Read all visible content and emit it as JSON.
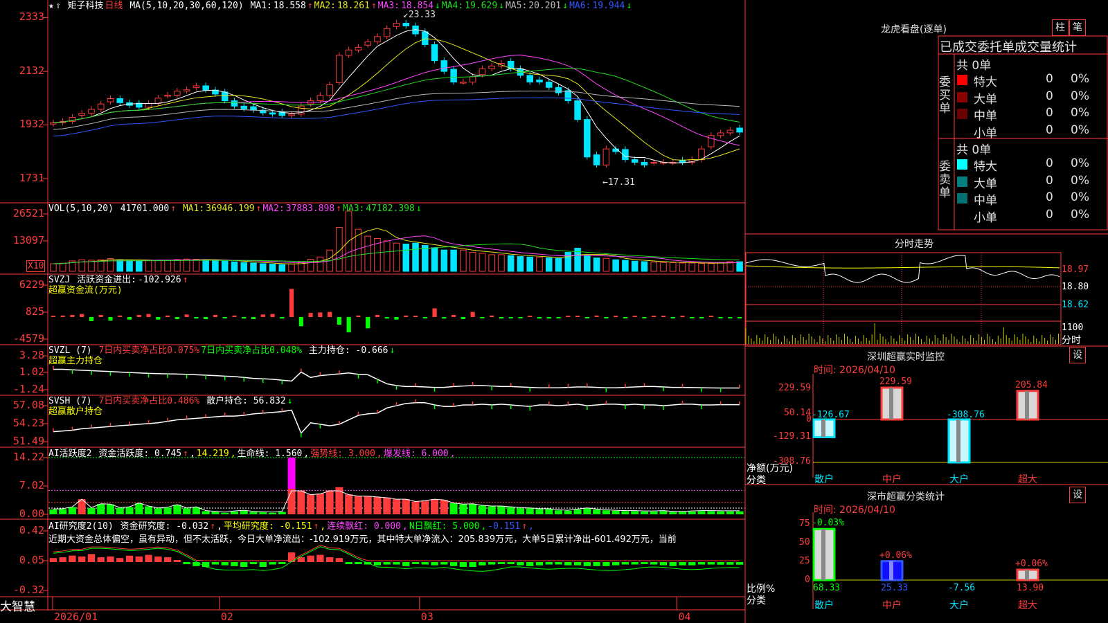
{
  "stock": {
    "name": "矩子科技",
    "period": "日线"
  },
  "colors": {
    "up": "#ff3c3c",
    "down": "#00e5ff",
    "bg": "#000000",
    "grid": "#ff3c3c",
    "ma1": "#ffffff",
    "ma2": "#e6e61e",
    "ma3": "#ff44ff",
    "ma4": "#22dd22",
    "ma5": "#bbbbbb",
    "ma6": "#3355ff"
  },
  "price_panel": {
    "ma_label": "MA(5,10,20,30,60,120)",
    "ma": [
      {
        "name": "MA1:",
        "value": "18.558",
        "arrow": "↑"
      },
      {
        "name": "MA2:",
        "value": "18.261",
        "arrow": "↑"
      },
      {
        "name": "MA3:",
        "value": "18.854",
        "arrow": "↓"
      },
      {
        "name": "MA4:",
        "value": "19.629",
        "arrow": "↓"
      },
      {
        "name": "MA5:",
        "value": "20.201",
        "arrow": "↓"
      },
      {
        "name": "MA6:",
        "value": "19.944",
        "arrow": "↓"
      }
    ],
    "y_ticks": [
      "2333",
      "2132",
      "1932",
      "1731"
    ],
    "high_label": "23.33",
    "low_label": "17.31"
  },
  "vol_panel": {
    "label": "VOL(5,10,20)",
    "value": "41701.000",
    "value_arrow": "↑",
    "ma": [
      {
        "name": "MA1:",
        "value": "36946.199",
        "arrow": "↑"
      },
      {
        "name": "MA2:",
        "value": "37883.898",
        "arrow": "↑"
      },
      {
        "name": "MA3:",
        "value": "47182.398",
        "arrow": "↓"
      }
    ],
    "y_ticks": [
      "26521",
      "13097"
    ],
    "unit": "X10"
  },
  "svzj_panel": {
    "label": "SVZJ",
    "item": "活跃资金进出:",
    "value": "-102.926",
    "arrow": "↑",
    "subtitle": "超赢资金流(万元)",
    "y_ticks": [
      "6229",
      "825",
      "-4579"
    ]
  },
  "svzl_panel": {
    "label": "SVZL (7)",
    "item1": "7日内买卖净占比0.075%",
    "item2": "7日内买卖净占比0.048%",
    "item3": "主力持仓: -0.666",
    "arrow": "↓",
    "subtitle": "超赢主力持仓",
    "y_ticks": [
      "3.28",
      "1.02",
      "-1.24"
    ]
  },
  "svsh_panel": {
    "label": "SVSH (7)",
    "item1": "7日内买卖净占比0.486%",
    "item2": "散户持仓: 56.832",
    "arrow": "↓",
    "subtitle": "超赢散户持仓",
    "y_ticks": [
      "57.08",
      "54.23",
      "51.49"
    ]
  },
  "ai_panel": {
    "label": "AI活跃度2",
    "items": [
      {
        "text": "资金活跃度: 0.745",
        "arrow": "↑",
        "color": "#ffffff"
      },
      {
        "text": "14.219",
        "arrow": "",
        "color": "#ffff00"
      },
      {
        "text": "生命线: 1.560",
        "arrow": "",
        "color": "#ffffff"
      },
      {
        "text": "强势线: 3.000",
        "arrow": "",
        "color": "#ff3c3c"
      },
      {
        "text": "爆发线: 6.000",
        "arrow": "",
        "color": "#ff44ff"
      }
    ],
    "y_ticks": [
      "14.22",
      "7.02",
      "0.00"
    ]
  },
  "research_panel": {
    "label": "AI研究度2(10)",
    "items": [
      {
        "text": "资金研究度: -0.032",
        "arrow": "↑",
        "color": "#ffffff"
      },
      {
        "text": "平均研究度: -0.151",
        "arrow": "↑",
        "color": "#ffff00"
      },
      {
        "text": "连续飘红: 0.000",
        "arrow": "",
        "color": "#ff44ff"
      },
      {
        "text": "N日飘红: 5.000",
        "arrow": "",
        "color": "#00ff00"
      },
      {
        "text": "-0.151",
        "arrow": "↑",
        "color": "#3355ff"
      }
    ],
    "commentary": "近期大资金总体偏空，虽有异动，但不太活跃，今日大单净流出：-102.919万元，其中特大单净流入：205.839万元，大单5日累计净出-601.492万元，当前",
    "y_ticks": [
      "0.42",
      "0.05",
      "-0.32"
    ]
  },
  "x_axis": {
    "labels": [
      "2026/01",
      "02",
      "03",
      "04"
    ],
    "brand": "大智慧"
  },
  "dragon_tiger": {
    "title": "龙虎看盘(逐单)",
    "btn_bar": "柱",
    "btn_pen": "笔",
    "header": "已成交委托单成交量统计",
    "buy": {
      "side": "委买单",
      "total": "共 0单",
      "rows": [
        {
          "label": "特大",
          "count": "0",
          "pct": "0%",
          "color": "#ff0000"
        },
        {
          "label": "大单",
          "count": "0",
          "pct": "0%",
          "color": "#8b0000"
        },
        {
          "label": "中单",
          "count": "0",
          "pct": "0%",
          "color": "#6b0000"
        },
        {
          "label": "小单",
          "count": "0",
          "pct": "0%",
          "color": "#000000"
        }
      ]
    },
    "sell": {
      "side": "委卖单",
      "total": "共 0单",
      "rows": [
        {
          "label": "特大",
          "count": "0",
          "pct": "0%",
          "color": "#00ffff"
        },
        {
          "label": "大单",
          "count": "0",
          "pct": "0%",
          "color": "#008080"
        },
        {
          "label": "中单",
          "count": "0",
          "pct": "0%",
          "color": "#007070"
        },
        {
          "label": "小单",
          "count": "0",
          "pct": "0%",
          "color": "#000000"
        }
      ]
    }
  },
  "intraday": {
    "title": "分时走势",
    "y_ticks": [
      "18.97",
      "18.80",
      "18.62"
    ],
    "vol_tick": "1100",
    "unit": "分时"
  },
  "monitor": {
    "title": "深圳超赢实时监控",
    "btn": "设",
    "time": "时间: 2026/04/10",
    "y_ticks": [
      "229.59",
      "50.14",
      "0",
      "-129.31",
      "-308.76"
    ],
    "ylabel1": "净额(万元)",
    "ylabel2": "分类",
    "categories": [
      "散户",
      "中户",
      "大户",
      "超大"
    ],
    "values": [
      -126.67,
      229.59,
      -308.76,
      205.84
    ],
    "value_labels": [
      "-126.67",
      "229.59",
      "-308.76",
      "205.84"
    ]
  },
  "classify": {
    "title": "深市超赢分类统计",
    "btn": "设",
    "time": "时间: 2026/04/10",
    "y_ticks": [
      "75",
      "50",
      "25",
      "0"
    ],
    "ylabel1": "比例%",
    "ylabel2": "分类",
    "categories": [
      "散户",
      "中户",
      "大户",
      "超大"
    ],
    "values": [
      68.33,
      25.33,
      -7.56,
      13.9
    ],
    "value_labels": [
      "68.33",
      "25.33",
      "-7.56",
      "13.90"
    ],
    "change_labels": [
      "-0.03%",
      "+0.06%",
      "",
      "+0.06%"
    ]
  },
  "chart_data": [
    {
      "type": "candlestick",
      "title": "矩子科技 日线",
      "ylim": [
        17.31,
        23.33
      ],
      "series": [
        {
          "name": "price_close",
          "values": [
            19.4,
            19.45,
            19.6,
            19.75,
            19.9,
            20.1,
            20.3,
            20.15,
            20.05,
            19.98,
            20.12,
            20.32,
            20.43,
            20.58,
            20.63,
            20.78,
            20.62,
            20.47,
            20.22,
            20.02,
            19.92,
            19.87,
            19.77,
            19.72,
            19.67,
            19.72,
            20.02,
            20.22,
            20.42,
            20.82,
            21.92,
            22.12,
            22.22,
            22.42,
            22.62,
            22.92,
            23.12,
            23.02,
            22.72,
            22.32,
            21.72,
            21.32,
            20.92,
            20.92,
            21.12,
            21.42,
            21.52,
            21.62,
            21.42,
            21.17,
            20.92,
            20.92,
            20.72,
            20.52,
            20.22,
            19.52,
            18.12,
            17.82,
            18.42,
            18.32,
            18.02,
            17.92,
            17.82,
            17.92,
            17.92,
            17.92,
            17.92,
            18.02,
            18.42,
            18.92,
            19.02,
            19.12,
            19.05
          ]
        }
      ]
    },
    {
      "type": "bar",
      "title": "VOL(5,10,20)",
      "ylim": [
        0,
        26521
      ],
      "series": [
        {
          "name": "volume",
          "values": [
            3300,
            3500,
            4500,
            5000,
            4800,
            5000,
            5500,
            5000,
            4700,
            4600,
            4600,
            4700,
            4800,
            5100,
            5300,
            5200,
            5100,
            4600,
            4400,
            4100,
            3800,
            3600,
            3300,
            3100,
            2900,
            3200,
            4200,
            5200,
            6200,
            9200,
            19000,
            26000,
            18200,
            15200,
            14200,
            13200,
            12200,
            11800,
            12200,
            11200,
            10200,
            9200,
            9200,
            9200,
            8200,
            7800,
            7200,
            7200,
            6800,
            6400,
            6200,
            6000,
            5800,
            5600,
            8200,
            10000,
            6800,
            5800,
            5600,
            5000,
            4800,
            4400,
            4200,
            4000,
            3800,
            3800,
            3600,
            3600,
            3400,
            3400,
            3800,
            4200,
            4170
          ]
        }
      ]
    },
    {
      "type": "bar",
      "title": "活跃资金进出",
      "ylim": [
        -4579,
        6229
      ],
      "series": [
        {
          "name": "flow",
          "values": [
            200,
            300,
            400,
            600,
            -800,
            400,
            -700,
            300,
            -500,
            400,
            600,
            -500,
            300,
            -400,
            500,
            -300,
            -400,
            400,
            -200,
            300,
            -300,
            -400,
            500,
            600,
            -300,
            5500,
            -1800,
            800,
            900,
            1000,
            -1500,
            -3000,
            300,
            -2200,
            400,
            -300,
            -500,
            300,
            200,
            -200,
            1700,
            -300,
            400,
            -400,
            1000,
            -200,
            300,
            -300,
            -200,
            -100,
            200,
            -300,
            -300,
            -100,
            200,
            100,
            -200,
            300,
            -200,
            200,
            -100,
            100,
            -100,
            100,
            200,
            -100,
            200,
            -100,
            -200,
            100,
            -102.9,
            -102.9,
            -102.9
          ]
        }
      ]
    },
    {
      "type": "line",
      "title": "主力持仓",
      "ylim": [
        -1.24,
        3.28
      ],
      "series": [
        {
          "name": "main_position",
          "values": [
            1.4,
            1.4,
            1.35,
            1.3,
            1.25,
            1.2,
            1.15,
            1.1,
            1.05,
            1.0,
            0.95,
            0.92,
            0.9,
            0.88,
            0.85,
            0.8,
            0.75,
            0.7,
            0.65,
            0.6,
            0.5,
            0.4,
            0.35,
            0.3,
            0.2,
            0.1,
            1.1,
            0.5,
            0.7,
            0.8,
            0.9,
            1.0,
            0.85,
            0.8,
            0.3,
            -0.2,
            -0.4,
            -0.5,
            -0.5,
            -0.55,
            -0.6,
            -0.6,
            -0.5,
            -0.45,
            -0.4,
            -0.4,
            -0.45,
            -0.5,
            -0.5,
            -0.55,
            -0.6,
            -0.65,
            -0.65,
            -0.65,
            -0.6,
            -0.55,
            -0.55,
            -0.6,
            -0.65,
            -0.65,
            -0.6,
            -0.55,
            -0.5,
            -0.5,
            -0.55,
            -0.6,
            -0.6,
            -0.62,
            -0.64,
            -0.66,
            -0.666,
            -0.666,
            -0.666
          ]
        }
      ]
    },
    {
      "type": "line",
      "title": "散户持仓",
      "ylim": [
        51.49,
        57.08
      ],
      "series": [
        {
          "name": "retail_position",
          "values": [
            53.2,
            53.3,
            53.4,
            53.6,
            53.7,
            53.8,
            53.9,
            54.0,
            54.1,
            54.2,
            54.3,
            54.4,
            54.6,
            54.8,
            54.9,
            55.0,
            55.1,
            55.2,
            55.3,
            55.3,
            55.4,
            55.6,
            55.7,
            55.8,
            55.9,
            56.1,
            53.0,
            54.4,
            54.2,
            54.0,
            54.2,
            54.8,
            55.4,
            55.6,
            55.7,
            56.4,
            56.7,
            57.0,
            57.1,
            57.1,
            56.8,
            56.6,
            56.6,
            56.8,
            56.8,
            56.9,
            56.8,
            56.9,
            56.8,
            56.7,
            56.6,
            56.8,
            56.8,
            56.7,
            56.8,
            56.9,
            56.7,
            56.8,
            56.9,
            56.9,
            56.8,
            56.9,
            56.8,
            56.8,
            56.7,
            56.8,
            56.9,
            56.9,
            56.8,
            56.8,
            56.832,
            56.832,
            56.832
          ]
        }
      ]
    },
    {
      "type": "bar",
      "title": "资金活跃度",
      "ylim": [
        0,
        14.22
      ],
      "series": [
        {
          "name": "activity",
          "values": [
            1.2,
            1.3,
            1.8,
            3.8,
            1.6,
            2.6,
            2.5,
            1.6,
            1.8,
            2.8,
            2.0,
            1.5,
            1.7,
            2.4,
            1.5,
            1.8,
            0.8,
            0.6,
            0.4,
            0.7,
            0.9,
            0.6,
            0.5,
            0.4,
            0.6,
            14.22,
            6.0,
            5.0,
            5.2,
            6.0,
            6.8,
            5.0,
            4.6,
            4.6,
            4.4,
            4.2,
            3.8,
            3.8,
            3.2,
            3.4,
            3.8,
            3.6,
            2.8,
            2.5,
            2.6,
            2.2,
            2.0,
            2.0,
            1.8,
            1.6,
            1.5,
            1.3,
            1.3,
            1.0,
            0.9,
            1.2,
            1.5,
            1.2,
            1.0,
            0.9,
            0.8,
            0.8,
            0.7,
            0.7,
            0.8,
            0.6,
            0.6,
            0.7,
            0.8,
            0.8,
            0.745,
            0.745,
            0.745
          ]
        }
      ]
    },
    {
      "type": "bar",
      "title": "资金研究度",
      "ylim": [
        -0.32,
        0.42
      ],
      "series": [
        {
          "name": "research",
          "values": [
            0.05,
            0.06,
            0.08,
            0.07,
            0.1,
            0.06,
            0.07,
            0.05,
            0.08,
            0.07,
            0.09,
            0.07,
            0.06,
            0.02,
            -0.02,
            -0.05,
            -0.06,
            -0.03,
            -0.04,
            -0.05,
            -0.06,
            -0.02,
            -0.06,
            -0.03,
            -0.02,
            0.12,
            0.06,
            0.08,
            0.09,
            0.06,
            0.05,
            -0.02,
            -0.02,
            -0.03,
            -0.04,
            -0.03,
            -0.03,
            -0.05,
            -0.02,
            -0.03,
            -0.04,
            -0.03,
            -0.05,
            -0.06,
            -0.06,
            -0.04,
            -0.03,
            -0.02,
            -0.02,
            -0.04,
            -0.05,
            -0.04,
            -0.03,
            -0.03,
            -0.04,
            -0.04,
            -0.05,
            -0.05,
            -0.05,
            -0.04,
            -0.03,
            -0.03,
            -0.02,
            -0.03,
            -0.04,
            -0.05,
            -0.04,
            -0.04,
            -0.03,
            -0.03,
            -0.032,
            -0.032,
            -0.032
          ]
        }
      ]
    }
  ]
}
